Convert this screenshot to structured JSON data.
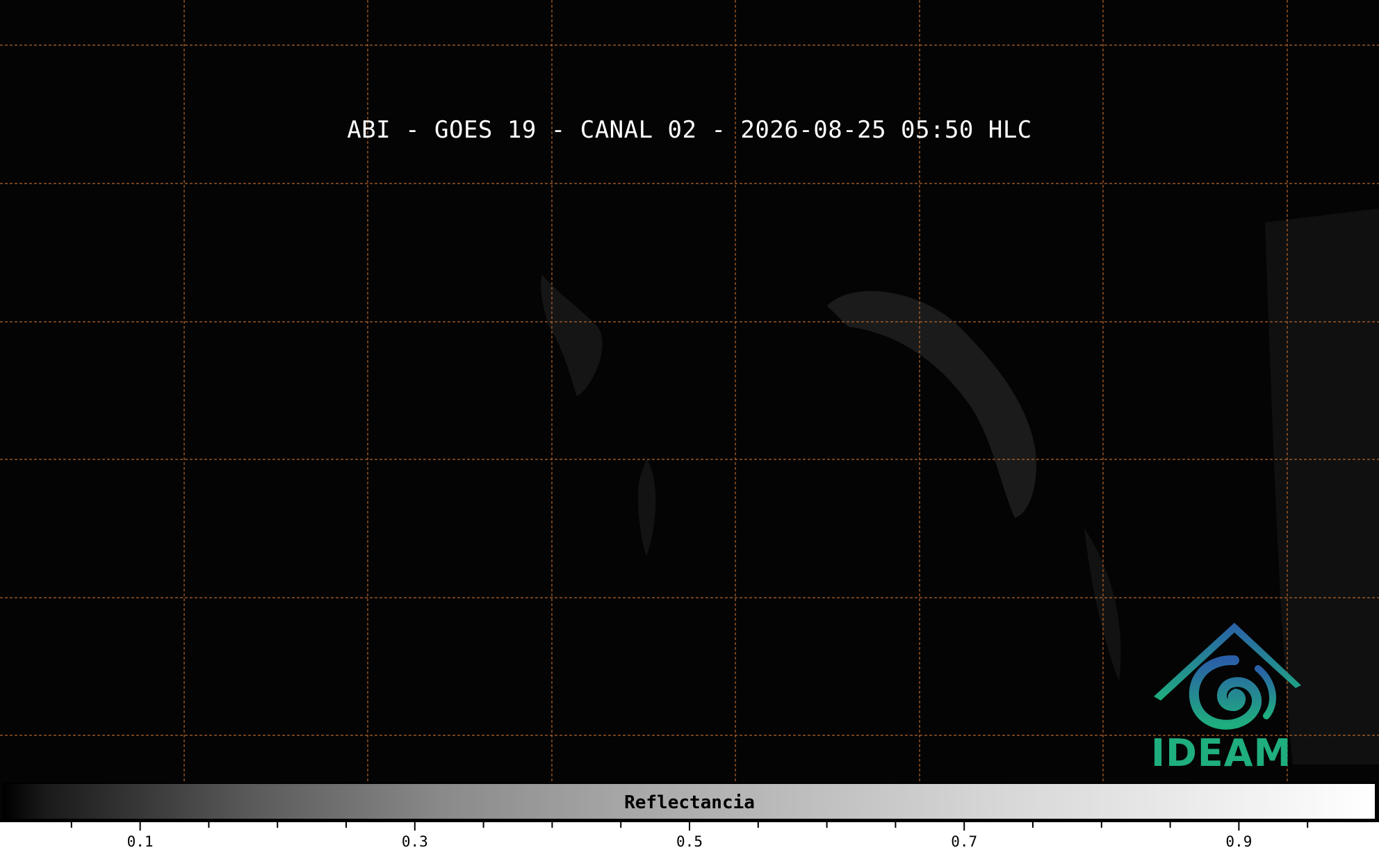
{
  "title": "ABI - GOES 19 - CANAL 02 - 2026-08-25 05:50 HLC",
  "logo": {
    "text": "IDEAM",
    "icon": "ideam-logo-icon",
    "colors": {
      "top": "#2a6fb0",
      "bottom": "#1fae7e"
    }
  },
  "colorbar": {
    "label": "Reflectancia",
    "min": 0.0,
    "max": 1.0,
    "tick_labels": [
      "0.1",
      "0.3",
      "0.5",
      "0.7",
      "0.9"
    ],
    "tick_values": [
      0.1,
      0.3,
      0.5,
      0.7,
      0.9
    ],
    "minor_tick_values": [
      0.05,
      0.15,
      0.2,
      0.25,
      0.35,
      0.4,
      0.45,
      0.55,
      0.6,
      0.65,
      0.75,
      0.8,
      0.85,
      0.95
    ]
  },
  "map": {
    "background": "#040404",
    "gridline_color": "#b5662e",
    "gridline_style": "dashed"
  }
}
